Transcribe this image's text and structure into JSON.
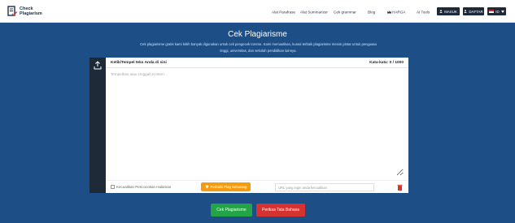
{
  "header": {
    "logo_line1": "Check",
    "logo_line2": "Plagiarism",
    "nav": {
      "paraphrase": "Alat Parafrase",
      "summarizer": "Alat Summarizer",
      "grammar": "Cek grammar",
      "blog": "Blog",
      "pricing": "HARGA",
      "ai_tools": "AI Tools",
      "login": "MASUK",
      "register": "DAFTAR",
      "language": "ID"
    }
  },
  "hero": {
    "title": "Cek Plagiarisme",
    "description_line1": "Cek plagiarisme gratis kami lebih banyak digunakan untuk cek pengecek toreme. Kami memastikan, kurasi terbaik plagiarisme mesim pintar untuk penguasa",
    "description_line2": "tinggi, universitas, dan sekolah pendidikan lainnya."
  },
  "editor": {
    "label": "Ketik/Tempel teks Anda di sini",
    "word_count": "Kata-kata: 0 / 1000",
    "placeholder": "Tempelkan atau Unggah Konten",
    "exclude_label": "Kecualikan Pencocokan Halaman",
    "fix_button": "Perbaiki Plag Sekarang",
    "url_placeholder": "URL yang ingin anda kecualikan"
  },
  "actions": {
    "check": "Cek Plagiarisme",
    "grammar": "Periksa Tata Bahasa"
  },
  "colors": {
    "background": "#1d4f86",
    "check_button": "#22a447",
    "grammar_button": "#d6322f",
    "fix_button": "#f39c12"
  }
}
